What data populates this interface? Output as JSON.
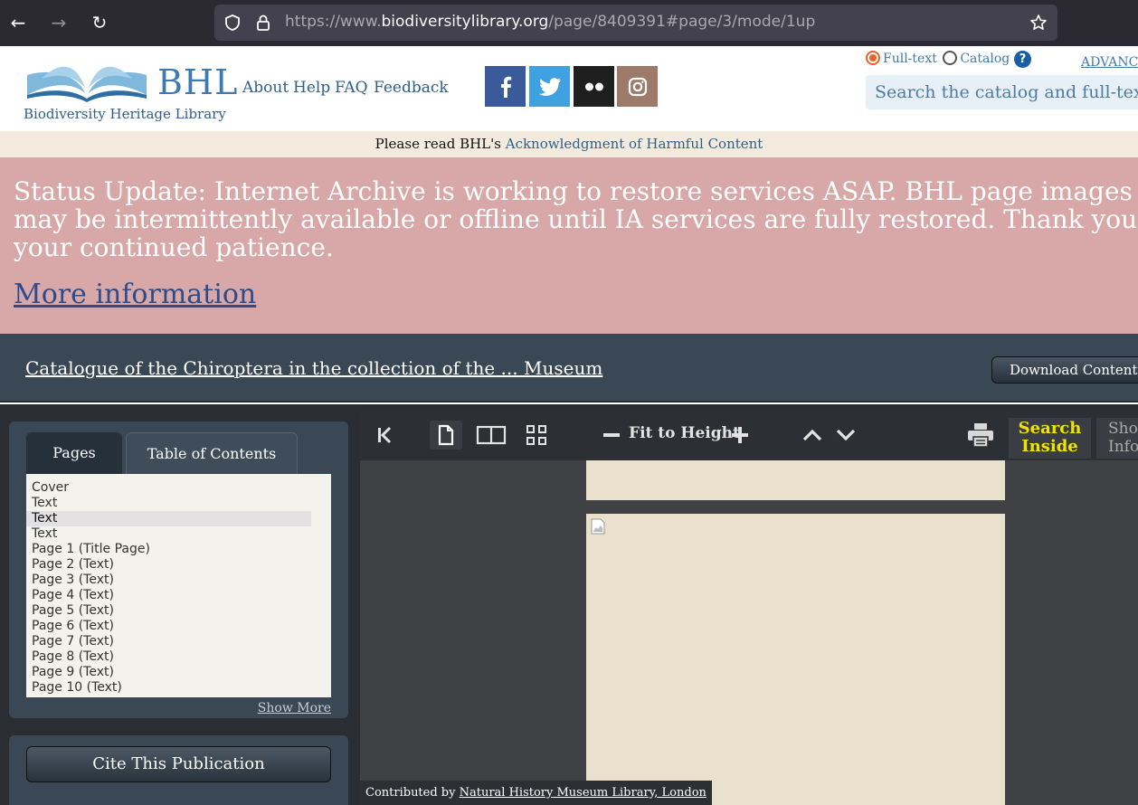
{
  "browser": {
    "url_prefix": "https://www.",
    "url_domain": "biodiversitylibrary.org",
    "url_path": "/page/8409391#page/3/mode/1up"
  },
  "header": {
    "logo_text": "BHL",
    "logo_subtitle": "Biodiversity Heritage Library",
    "nav": [
      "About",
      "Help",
      "FAQ",
      "Feedback"
    ],
    "social": [
      "facebook",
      "twitter",
      "flickr",
      "instagram"
    ],
    "search": {
      "option_fulltext": "Full-text",
      "option_catalog": "Catalog",
      "advanced": "ADVANC",
      "placeholder": "Search the catalog and full-text"
    }
  },
  "notice": {
    "prefix": "Please read BHL's ",
    "link": "Acknowledgment of Harmful Content"
  },
  "status": {
    "text": "Status Update: Internet Archive is working to restore services ASAP. BHL page images may be intermittently available or offline until IA services are fully restored. Thank you for your continued patience.",
    "more_link": "More information"
  },
  "book": {
    "title": "Catalogue of the Chiroptera in the collection of the ... Museum",
    "download_label": "Download Contents"
  },
  "sidebar": {
    "tab_pages": "Pages",
    "tab_toc": "Table of Contents",
    "pages": [
      "Cover",
      "Text",
      "Text",
      "Text",
      "Page 1 (Title Page)",
      "Page 2 (Text)",
      "Page 3 (Text)",
      "Page 4 (Text)",
      "Page 5 (Text)",
      "Page 6 (Text)",
      "Page 7 (Text)",
      "Page 8 (Text)",
      "Page 9 (Text)",
      "Page 10 (Text)"
    ],
    "selected_index": 2,
    "show_more": "Show More",
    "cite_label": "Cite This Publication"
  },
  "toolbar": {
    "fit_label": "Fit to Height",
    "search_inside_line1": "Search",
    "search_inside_line2": "Inside",
    "show_info_line1": "Show",
    "show_info_line2": "Info"
  },
  "viewer": {
    "contributed_prefix": "Contributed by ",
    "contributor": "Natural History Museum Library, London"
  },
  "colors": {
    "banner": "#d8a7a8",
    "titlebar": "#3a4856",
    "link": "#2e5f8c",
    "search_inside": "#f2e400"
  }
}
